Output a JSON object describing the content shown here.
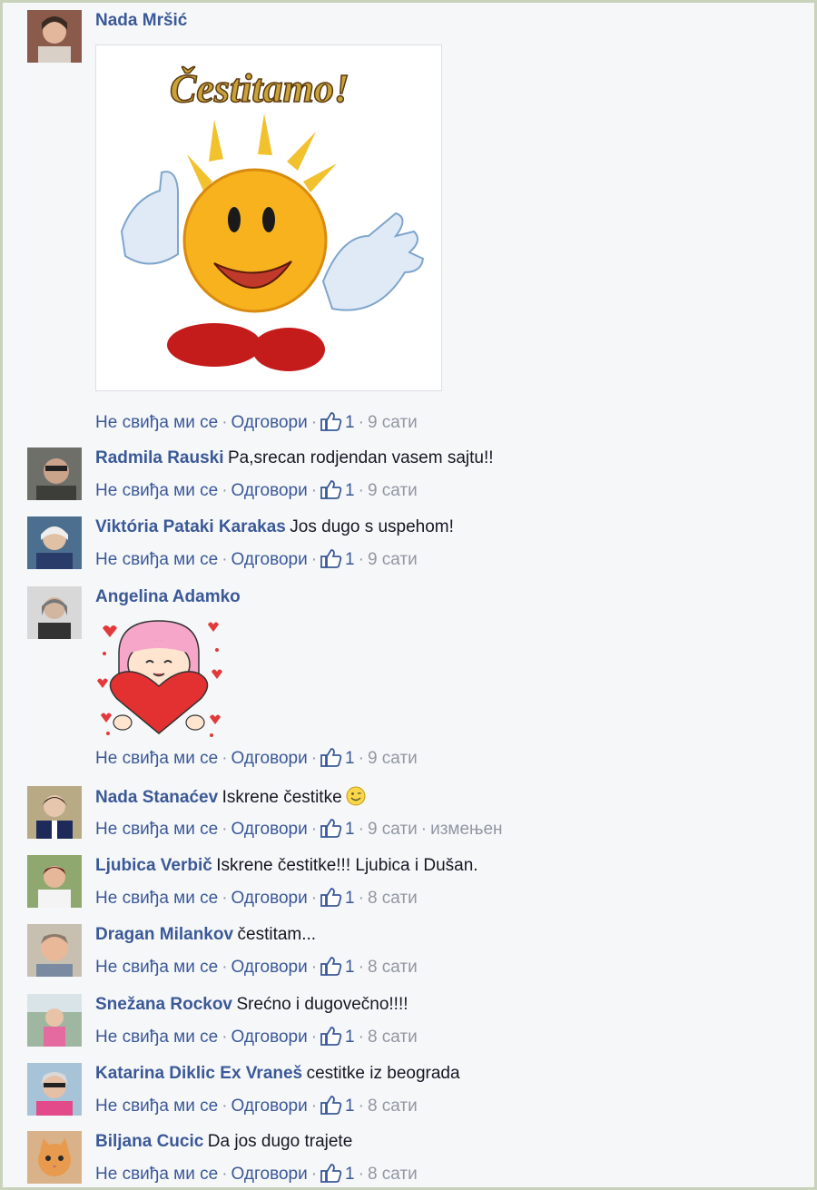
{
  "actions": {
    "unlike": "Не свиђа ми се",
    "reply": "Одговори",
    "separator": "·"
  },
  "comments": [
    {
      "author": "Nada Mršić",
      "text": "",
      "attachment": {
        "kind": "image",
        "caption": "Čestitamo!"
      },
      "likes": "1",
      "time": "9 сати",
      "edited": ""
    },
    {
      "author": "Radmila Rauski",
      "text": "Pa,srecan rodjendan vasem sajtu!!",
      "likes": "1",
      "time": "9 сати",
      "edited": ""
    },
    {
      "author": "Viktória Pataki Karakas",
      "text": "Jos dugo s uspehom!",
      "likes": "1",
      "time": "9 сати",
      "edited": ""
    },
    {
      "author": "Angelina Adamko",
      "text": "",
      "attachment": {
        "kind": "sticker"
      },
      "likes": "1",
      "time": "9 сати",
      "edited": ""
    },
    {
      "author": "Nada Stanaćev",
      "text": "Iskrene čestitke",
      "emoji": "smile-wink-emoji",
      "likes": "1",
      "time": "9 сати",
      "edited": "измењен"
    },
    {
      "author": "Ljubica Verbič",
      "text": "Iskrene čestitke!!! Ljubica i Dušan.",
      "likes": "1",
      "time": "8 сати",
      "edited": ""
    },
    {
      "author": "Dragan Milankov",
      "text": "čestitam...",
      "likes": "1",
      "time": "8 сати",
      "edited": ""
    },
    {
      "author": "Snežana Rockov",
      "text": "Srećno i dugovečno!!!!",
      "likes": "1",
      "time": "8 сати",
      "edited": ""
    },
    {
      "author": "Katarina Diklic Ex Vraneš",
      "text": "cestitke iz beograda",
      "likes": "1",
      "time": "8 сати",
      "edited": ""
    },
    {
      "author": "Biljana Cucic",
      "text": "Da jos dugo trajete",
      "likes": "1",
      "time": "8 сати",
      "edited": ""
    }
  ],
  "colors": {
    "link": "#3b5998",
    "meta": "#9197a3",
    "text": "#141823",
    "background": "#f6f7f9"
  }
}
